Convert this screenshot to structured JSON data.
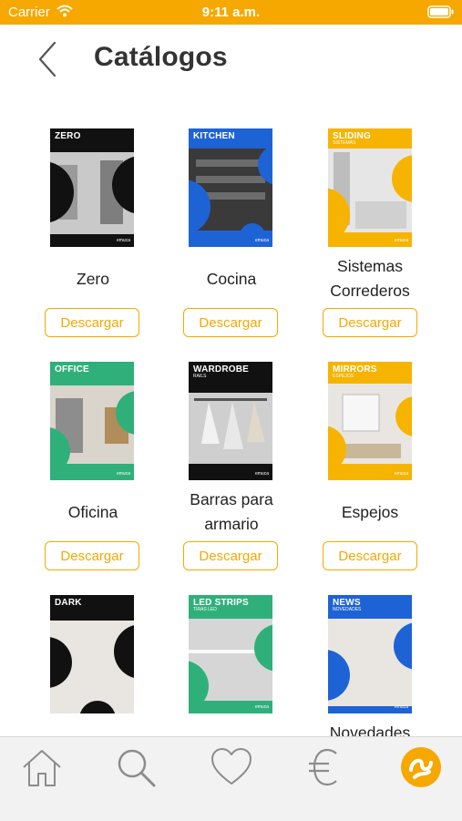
{
  "status_bar": {
    "carrier": "Carrier",
    "time": "9:11 a.m."
  },
  "header": {
    "title": "Catálogos"
  },
  "catalogs": [
    {
      "name": "Zero",
      "cover_title": "ZERO",
      "cover_subtitle": "",
      "color": "#111111",
      "button": "Descargar"
    },
    {
      "name": "Cocina",
      "cover_title": "KITCHEN",
      "cover_subtitle": "",
      "color": "#1e63d6",
      "button": "Descargar"
    },
    {
      "name": "Sistemas Correderos",
      "cover_title": "SLIDING",
      "cover_subtitle": "SISTEMAS",
      "color": "#f6b400",
      "button": "Descargar"
    },
    {
      "name": "Oficina",
      "cover_title": "OFFICE",
      "cover_subtitle": "",
      "color": "#2fb07a",
      "button": "Descargar"
    },
    {
      "name": "Barras para armario",
      "cover_title": "WARDROBE",
      "cover_subtitle": "RAILS",
      "color": "#111111",
      "button": "Descargar"
    },
    {
      "name": "Espejos",
      "cover_title": "MIRRORS",
      "cover_subtitle": "ESPEJOS",
      "color": "#f6b400",
      "button": "Descargar"
    },
    {
      "name": "",
      "cover_title": "DARK",
      "cover_subtitle": "",
      "color": "#111111",
      "button": ""
    },
    {
      "name": "",
      "cover_title": "LED STRIPS",
      "cover_subtitle": "TIRAS LED",
      "color": "#2fb07a",
      "button": ""
    },
    {
      "name": "Novedades",
      "cover_title": "NEWS",
      "cover_subtitle": "NOVEDADES",
      "color": "#1e63d6",
      "button": ""
    }
  ],
  "cover_brand": "emuca",
  "tab_bar": {
    "items": [
      "home-icon",
      "search-icon",
      "heart-icon",
      "euro-icon",
      "emuca-logo-icon"
    ],
    "active_color": "#f6a800",
    "inactive_color": "#8c8c8c"
  }
}
